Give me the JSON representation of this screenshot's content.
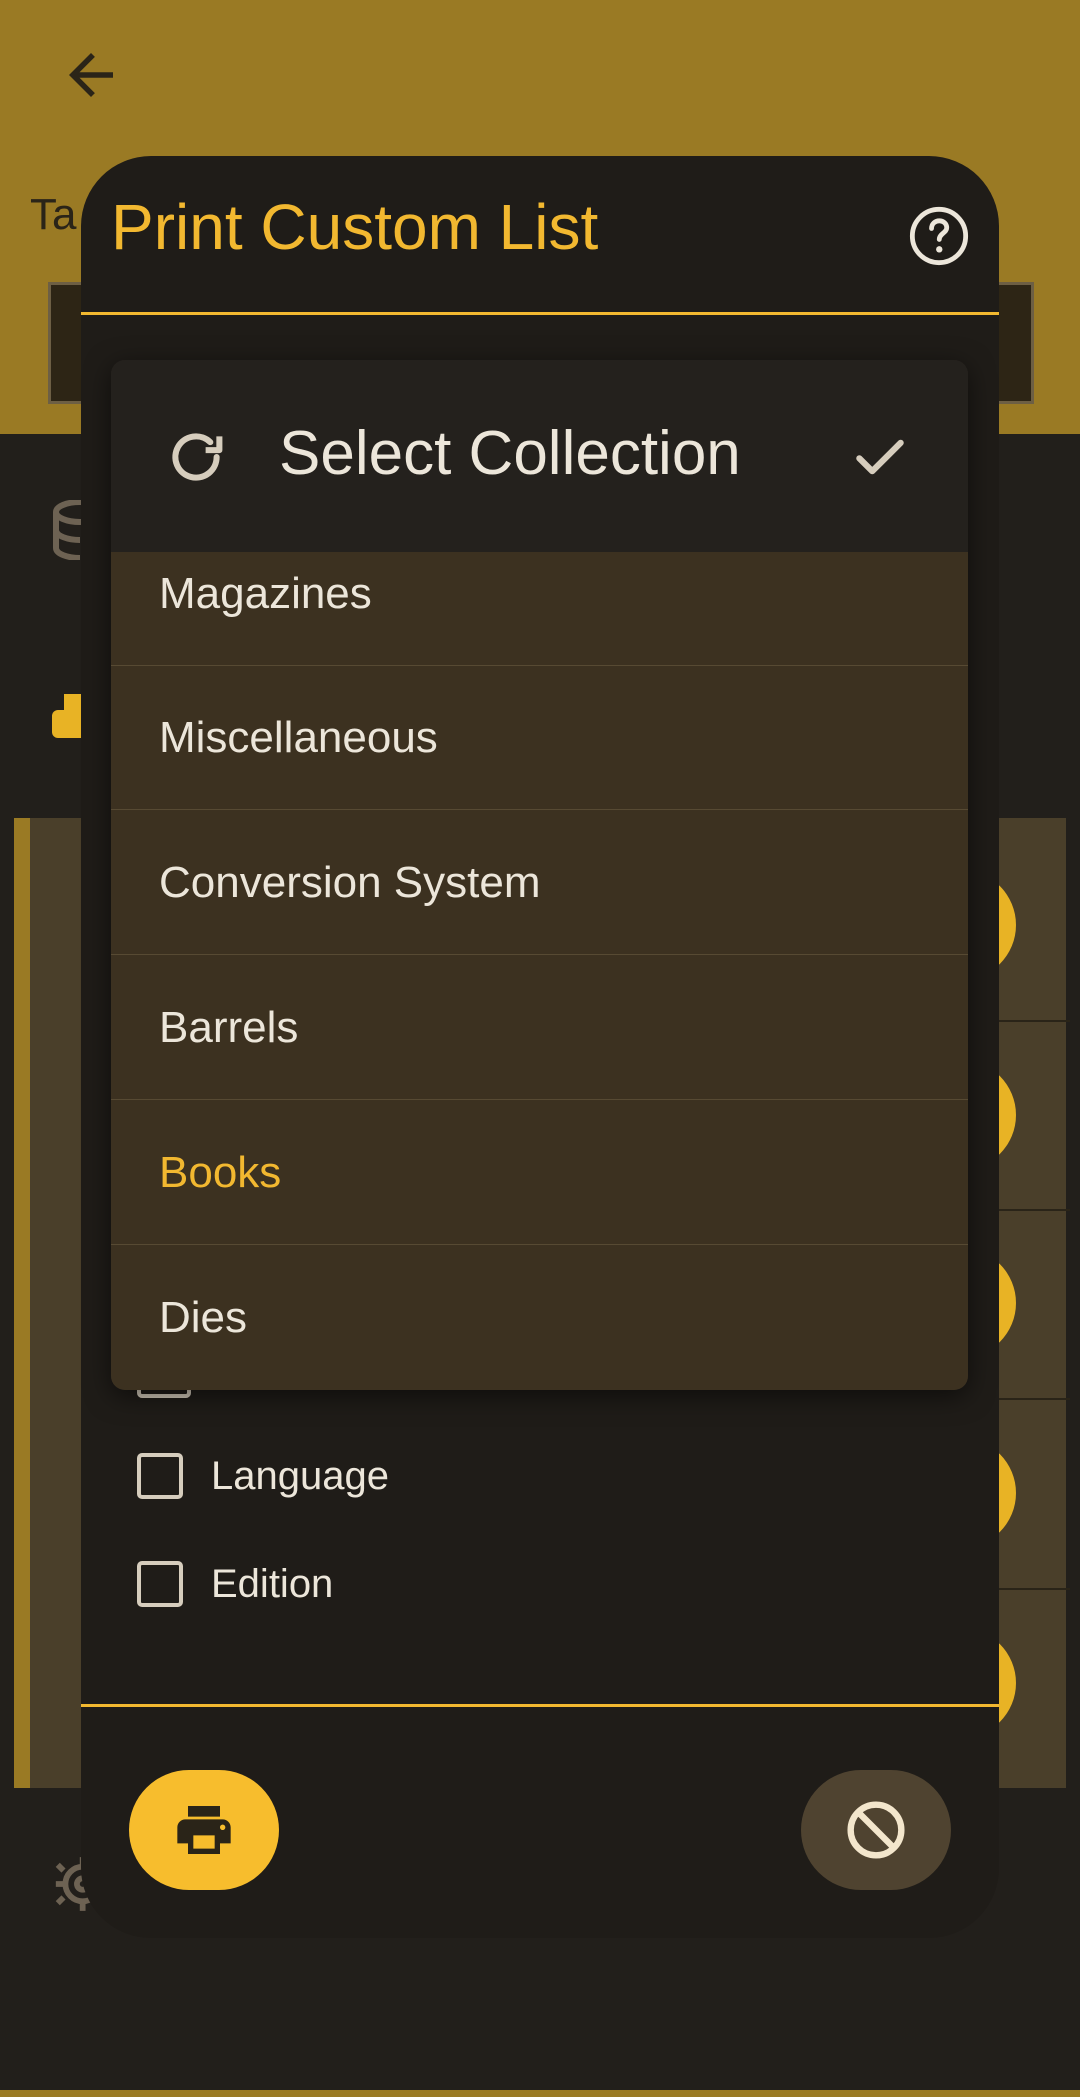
{
  "background": {
    "title_partial": "Ta"
  },
  "dialog": {
    "title": "Print Custom List",
    "checkbox_options": [
      {
        "label": "Language",
        "checked": false
      },
      {
        "label": "Edition",
        "checked": false
      }
    ]
  },
  "popup": {
    "title": "Select Collection",
    "items": [
      {
        "label": "Magazines",
        "selected": false
      },
      {
        "label": "Miscellaneous",
        "selected": false
      },
      {
        "label": "Conversion System",
        "selected": false
      },
      {
        "label": "Barrels",
        "selected": false
      },
      {
        "label": "Books",
        "selected": true
      },
      {
        "label": "Dies",
        "selected": false
      }
    ]
  },
  "icons": [
    "back-arrow-icon",
    "help-icon",
    "refresh-icon",
    "checkmark-icon",
    "printer-icon",
    "cancel-icon",
    "database-icon",
    "gear-icon"
  ],
  "colors": {
    "accent": "#f2b830",
    "app_bar": "#9a7a24",
    "dialog_bg": "#1f1c18",
    "list_bg": "#3c3120",
    "cancel_bg": "#4f4330"
  }
}
